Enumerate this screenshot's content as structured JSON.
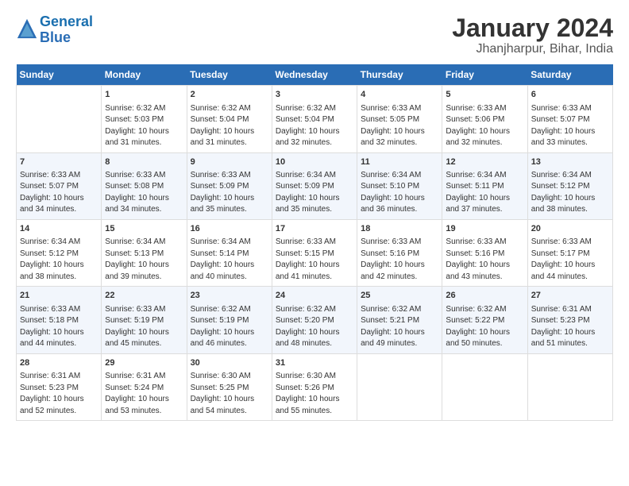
{
  "logo": {
    "line1": "General",
    "line2": "Blue"
  },
  "title": "January 2024",
  "subtitle": "Jhanjharpur, Bihar, India",
  "days_header": [
    "Sunday",
    "Monday",
    "Tuesday",
    "Wednesday",
    "Thursday",
    "Friday",
    "Saturday"
  ],
  "weeks": [
    [
      {
        "num": "",
        "info": ""
      },
      {
        "num": "1",
        "info": "Sunrise: 6:32 AM\nSunset: 5:03 PM\nDaylight: 10 hours\nand 31 minutes."
      },
      {
        "num": "2",
        "info": "Sunrise: 6:32 AM\nSunset: 5:04 PM\nDaylight: 10 hours\nand 31 minutes."
      },
      {
        "num": "3",
        "info": "Sunrise: 6:32 AM\nSunset: 5:04 PM\nDaylight: 10 hours\nand 32 minutes."
      },
      {
        "num": "4",
        "info": "Sunrise: 6:33 AM\nSunset: 5:05 PM\nDaylight: 10 hours\nand 32 minutes."
      },
      {
        "num": "5",
        "info": "Sunrise: 6:33 AM\nSunset: 5:06 PM\nDaylight: 10 hours\nand 32 minutes."
      },
      {
        "num": "6",
        "info": "Sunrise: 6:33 AM\nSunset: 5:07 PM\nDaylight: 10 hours\nand 33 minutes."
      }
    ],
    [
      {
        "num": "7",
        "info": "Sunrise: 6:33 AM\nSunset: 5:07 PM\nDaylight: 10 hours\nand 34 minutes."
      },
      {
        "num": "8",
        "info": "Sunrise: 6:33 AM\nSunset: 5:08 PM\nDaylight: 10 hours\nand 34 minutes."
      },
      {
        "num": "9",
        "info": "Sunrise: 6:33 AM\nSunset: 5:09 PM\nDaylight: 10 hours\nand 35 minutes."
      },
      {
        "num": "10",
        "info": "Sunrise: 6:34 AM\nSunset: 5:09 PM\nDaylight: 10 hours\nand 35 minutes."
      },
      {
        "num": "11",
        "info": "Sunrise: 6:34 AM\nSunset: 5:10 PM\nDaylight: 10 hours\nand 36 minutes."
      },
      {
        "num": "12",
        "info": "Sunrise: 6:34 AM\nSunset: 5:11 PM\nDaylight: 10 hours\nand 37 minutes."
      },
      {
        "num": "13",
        "info": "Sunrise: 6:34 AM\nSunset: 5:12 PM\nDaylight: 10 hours\nand 38 minutes."
      }
    ],
    [
      {
        "num": "14",
        "info": "Sunrise: 6:34 AM\nSunset: 5:12 PM\nDaylight: 10 hours\nand 38 minutes."
      },
      {
        "num": "15",
        "info": "Sunrise: 6:34 AM\nSunset: 5:13 PM\nDaylight: 10 hours\nand 39 minutes."
      },
      {
        "num": "16",
        "info": "Sunrise: 6:34 AM\nSunset: 5:14 PM\nDaylight: 10 hours\nand 40 minutes."
      },
      {
        "num": "17",
        "info": "Sunrise: 6:33 AM\nSunset: 5:15 PM\nDaylight: 10 hours\nand 41 minutes."
      },
      {
        "num": "18",
        "info": "Sunrise: 6:33 AM\nSunset: 5:16 PM\nDaylight: 10 hours\nand 42 minutes."
      },
      {
        "num": "19",
        "info": "Sunrise: 6:33 AM\nSunset: 5:16 PM\nDaylight: 10 hours\nand 43 minutes."
      },
      {
        "num": "20",
        "info": "Sunrise: 6:33 AM\nSunset: 5:17 PM\nDaylight: 10 hours\nand 44 minutes."
      }
    ],
    [
      {
        "num": "21",
        "info": "Sunrise: 6:33 AM\nSunset: 5:18 PM\nDaylight: 10 hours\nand 44 minutes."
      },
      {
        "num": "22",
        "info": "Sunrise: 6:33 AM\nSunset: 5:19 PM\nDaylight: 10 hours\nand 45 minutes."
      },
      {
        "num": "23",
        "info": "Sunrise: 6:32 AM\nSunset: 5:19 PM\nDaylight: 10 hours\nand 46 minutes."
      },
      {
        "num": "24",
        "info": "Sunrise: 6:32 AM\nSunset: 5:20 PM\nDaylight: 10 hours\nand 48 minutes."
      },
      {
        "num": "25",
        "info": "Sunrise: 6:32 AM\nSunset: 5:21 PM\nDaylight: 10 hours\nand 49 minutes."
      },
      {
        "num": "26",
        "info": "Sunrise: 6:32 AM\nSunset: 5:22 PM\nDaylight: 10 hours\nand 50 minutes."
      },
      {
        "num": "27",
        "info": "Sunrise: 6:31 AM\nSunset: 5:23 PM\nDaylight: 10 hours\nand 51 minutes."
      }
    ],
    [
      {
        "num": "28",
        "info": "Sunrise: 6:31 AM\nSunset: 5:23 PM\nDaylight: 10 hours\nand 52 minutes."
      },
      {
        "num": "29",
        "info": "Sunrise: 6:31 AM\nSunset: 5:24 PM\nDaylight: 10 hours\nand 53 minutes."
      },
      {
        "num": "30",
        "info": "Sunrise: 6:30 AM\nSunset: 5:25 PM\nDaylight: 10 hours\nand 54 minutes."
      },
      {
        "num": "31",
        "info": "Sunrise: 6:30 AM\nSunset: 5:26 PM\nDaylight: 10 hours\nand 55 minutes."
      },
      {
        "num": "",
        "info": ""
      },
      {
        "num": "",
        "info": ""
      },
      {
        "num": "",
        "info": ""
      }
    ]
  ]
}
